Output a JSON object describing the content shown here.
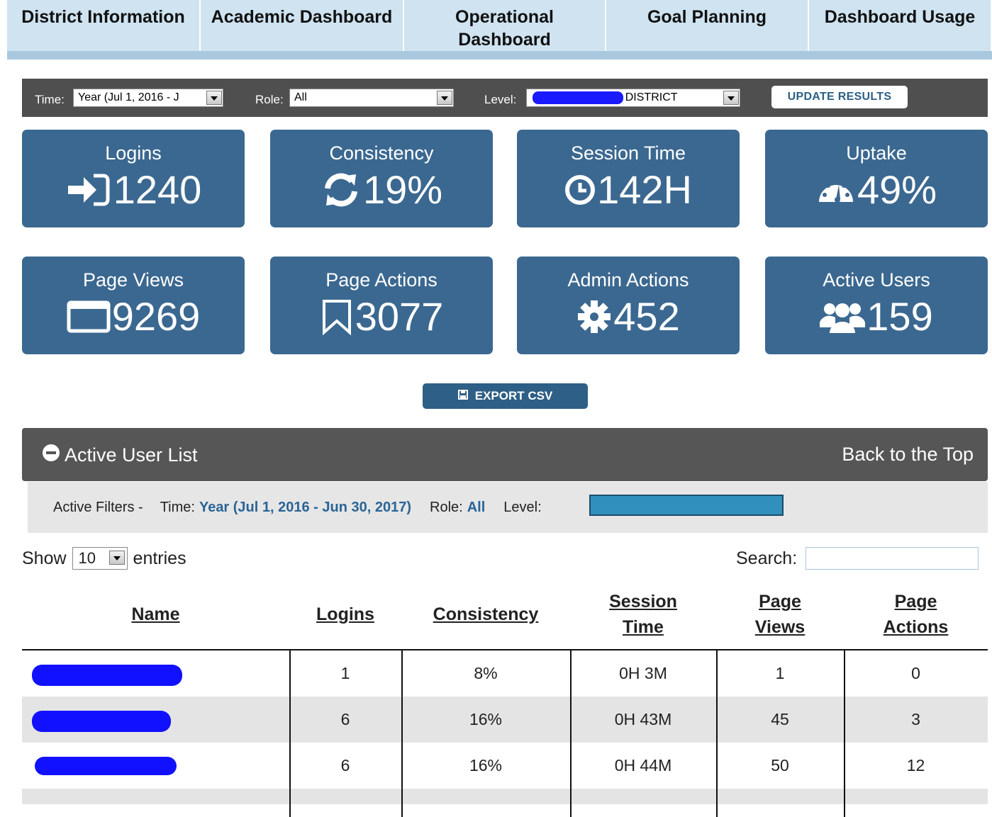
{
  "tabs": [
    "District Information",
    "Academic Dashboard",
    "Operational Dashboard",
    "Goal Planning",
    "Dashboard Usage"
  ],
  "filters": {
    "time_label": "Time:",
    "time_value": "Year (Jul 1, 2016 - J",
    "role_label": "Role:",
    "role_value": "All",
    "level_label": "Level:",
    "level_value": "L DISTRICT",
    "update_button": "UPDATE RESULTS"
  },
  "metrics": [
    {
      "title": "Logins",
      "value": "1240",
      "icon": "sign-in-icon"
    },
    {
      "title": "Consistency",
      "value": "19%",
      "icon": "refresh-icon"
    },
    {
      "title": "Session Time",
      "value": "142H",
      "icon": "clock-icon"
    },
    {
      "title": "Uptake",
      "value": "49%",
      "icon": "dashboard-gauge-icon"
    },
    {
      "title": "Page Views",
      "value": "9269",
      "icon": "window-icon"
    },
    {
      "title": "Page Actions",
      "value": "3077",
      "icon": "bookmark-icon"
    },
    {
      "title": "Admin Actions",
      "value": "452",
      "icon": "gear-icon"
    },
    {
      "title": "Active Users",
      "value": "159",
      "icon": "users-icon"
    }
  ],
  "export_button": "EXPORT CSV",
  "active_user_list": {
    "title": "Active User List",
    "back_to_top": "Back to the Top"
  },
  "active_filters": {
    "label": "Active Filters -",
    "time_label": "Time:",
    "time_value": "Year (Jul 1, 2016 - Jun 30, 2017)",
    "role_label": "Role:",
    "role_value": "All",
    "level_label": "Level:"
  },
  "length_control": {
    "show": "Show",
    "value": "10",
    "entries": "entries"
  },
  "search": {
    "label": "Search:",
    "value": ""
  },
  "table": {
    "headers": [
      "Name",
      "Logins",
      "Consistency",
      "Session Time",
      "Page Views",
      "Page Actions"
    ],
    "rows": [
      {
        "logins": "1",
        "consistency": "8%",
        "session_time": "0H 3M",
        "page_views": "1",
        "page_actions": "0"
      },
      {
        "logins": "6",
        "consistency": "16%",
        "session_time": "0H 43M",
        "page_views": "45",
        "page_actions": "3"
      },
      {
        "logins": "6",
        "consistency": "16%",
        "session_time": "0H 44M",
        "page_views": "50",
        "page_actions": "12"
      }
    ]
  },
  "colors": {
    "tab_bg": "#cfe3f1",
    "card_bg": "#3b6890",
    "filter_bar_bg": "#4f4f4f",
    "link_blue": "#2a6496",
    "row_stripe": "#e4e4e4"
  }
}
